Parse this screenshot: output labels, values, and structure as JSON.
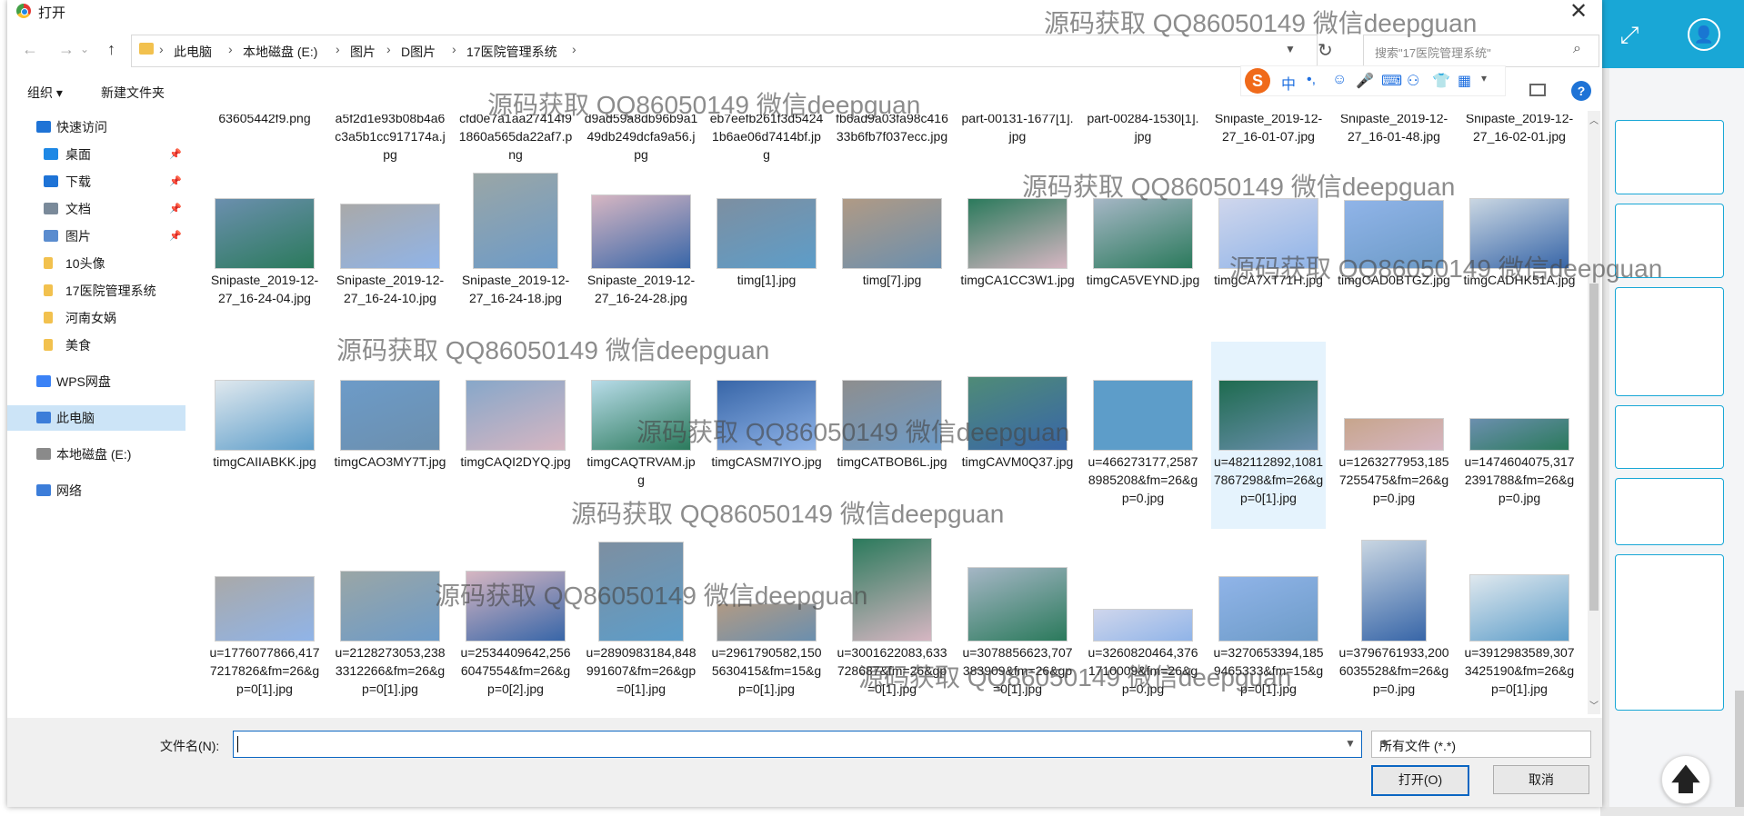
{
  "dialog": {
    "title": "打开",
    "breadcrumbs": [
      "此电脑",
      "本地磁盘 (E:)",
      "图片",
      "D图片",
      "17医院管理系统"
    ],
    "search_placeholder": "搜索\"17医院管理系统\"",
    "toolbar": {
      "organize": "组织 ▾",
      "new_folder": "新建文件夹"
    },
    "sidebar": [
      {
        "label": "快速访问",
        "icon": "star-icon",
        "pinned": false
      },
      {
        "label": "桌面",
        "icon": "desktop-icon",
        "pinned": true
      },
      {
        "label": "下载",
        "icon": "download-icon",
        "pinned": true
      },
      {
        "label": "文档",
        "icon": "document-icon",
        "pinned": true
      },
      {
        "label": "图片",
        "icon": "picture-icon",
        "pinned": true
      },
      {
        "label": "10头像",
        "icon": "folder-icon",
        "pinned": false
      },
      {
        "label": "17医院管理系统",
        "icon": "folder-icon",
        "pinned": false
      },
      {
        "label": "河南女娲",
        "icon": "folder-icon",
        "pinned": false
      },
      {
        "label": "美食",
        "icon": "folder-icon",
        "pinned": false
      },
      {
        "label": "WPS网盘",
        "icon": "cloud-icon",
        "pinned": false
      },
      {
        "label": "此电脑",
        "icon": "computer-icon",
        "pinned": false,
        "selected": true
      },
      {
        "label": "本地磁盘 (E:)",
        "icon": "drive-icon",
        "pinned": false
      },
      {
        "label": "网络",
        "icon": "network-icon",
        "pinned": false
      }
    ],
    "files": [
      {
        "name": "63605442f9.png"
      },
      {
        "name": "a5f2d1e93b08b4a6c3a5b1cc917174a.jpg"
      },
      {
        "name": "cfd0e7a1aa27414f91860a565da22af7.png"
      },
      {
        "name": "d9ad59a8db96b9a149db249dcfa9a56.jpg"
      },
      {
        "name": "eb7eefb261f3d54241b6ae06d7414bf.jpg"
      },
      {
        "name": "fb6ad9a03fa98c41633b6fb7f037ecc.jpg"
      },
      {
        "name": "part-00131-1677[1].jpg"
      },
      {
        "name": "part-00284-1530[1].jpg"
      },
      {
        "name": "Snipaste_2019-12-27_16-01-07.jpg"
      },
      {
        "name": "Snipaste_2019-12-27_16-01-48.jpg"
      },
      {
        "name": "Snipaste_2019-12-27_16-02-01.jpg"
      },
      {
        "name": "Snipaste_2019-12-27_16-24-04.jpg"
      },
      {
        "name": "Snipaste_2019-12-27_16-24-10.jpg"
      },
      {
        "name": "Snipaste_2019-12-27_16-24-18.jpg"
      },
      {
        "name": "Snipaste_2019-12-27_16-24-28.jpg"
      },
      {
        "name": "timg[1].jpg"
      },
      {
        "name": "timg[7].jpg"
      },
      {
        "name": "timgCA1CC3W1.jpg"
      },
      {
        "name": "timgCA5VEYND.jpg"
      },
      {
        "name": "timgCA7XT71H.jpg"
      },
      {
        "name": "timgCAD0BTGZ.jpg"
      },
      {
        "name": "timgCADHK51A.jpg"
      },
      {
        "name": "timgCAIIABKK.jpg"
      },
      {
        "name": "timgCAO3MY7T.jpg"
      },
      {
        "name": "timgCAQI2DYQ.jpg"
      },
      {
        "name": "timgCAQTRVAM.jpg"
      },
      {
        "name": "timgCASM7IYO.jpg"
      },
      {
        "name": "timgCATBOB6L.jpg"
      },
      {
        "name": "timgCAVM0Q37.jpg"
      },
      {
        "name": "u=466273177,25878985208&fm=26&gp=0.jpg"
      },
      {
        "name": "u=482112892,10817867298&fm=26&gp=0[1].jpg",
        "selected": true
      },
      {
        "name": "u=1263277953,1857255475&fm=26&gp=0.jpg"
      },
      {
        "name": "u=1474604075,3172391788&fm=26&gp=0.jpg"
      },
      {
        "name": "u=1776077866,4177217826&fm=26&gp=0[1].jpg"
      },
      {
        "name": "u=2128273053,2383312266&fm=26&gp=0[1].jpg"
      },
      {
        "name": "u=2534409642,2566047554&fm=26&gp=0[2].jpg"
      },
      {
        "name": "u=2890983184,848991607&fm=26&gp=0[1].jpg"
      },
      {
        "name": "u=2961790582,1505630415&fm=15&gp=0[1].jpg"
      },
      {
        "name": "u=3001622083,633728687&fm=26&gp=0[1].jpg"
      },
      {
        "name": "u=3078856623,707383909&fm=26&gp=0[1].jpg"
      },
      {
        "name": "u=3260820464,3761710009&fm=26&gp=0.jpg"
      },
      {
        "name": "u=3270653394,1859465333&fm=15&gp=0[1].jpg"
      },
      {
        "name": "u=3796761933,2006035528&fm=26&gp=0.jpg"
      },
      {
        "name": "u=3912983589,3073425190&fm=26&gp=0[1].jpg"
      }
    ],
    "filename_label": "文件名(N):",
    "filename_value": "",
    "filetype": "所有文件 (*.*)",
    "open_button": "打开(O)",
    "cancel_button": "取消"
  },
  "watermark": "源码获取 QQ86050149 微信deepguan",
  "colors": {
    "accent": "#19a7d6",
    "selection": "#cce4f7",
    "focus": "#0b66c2"
  }
}
